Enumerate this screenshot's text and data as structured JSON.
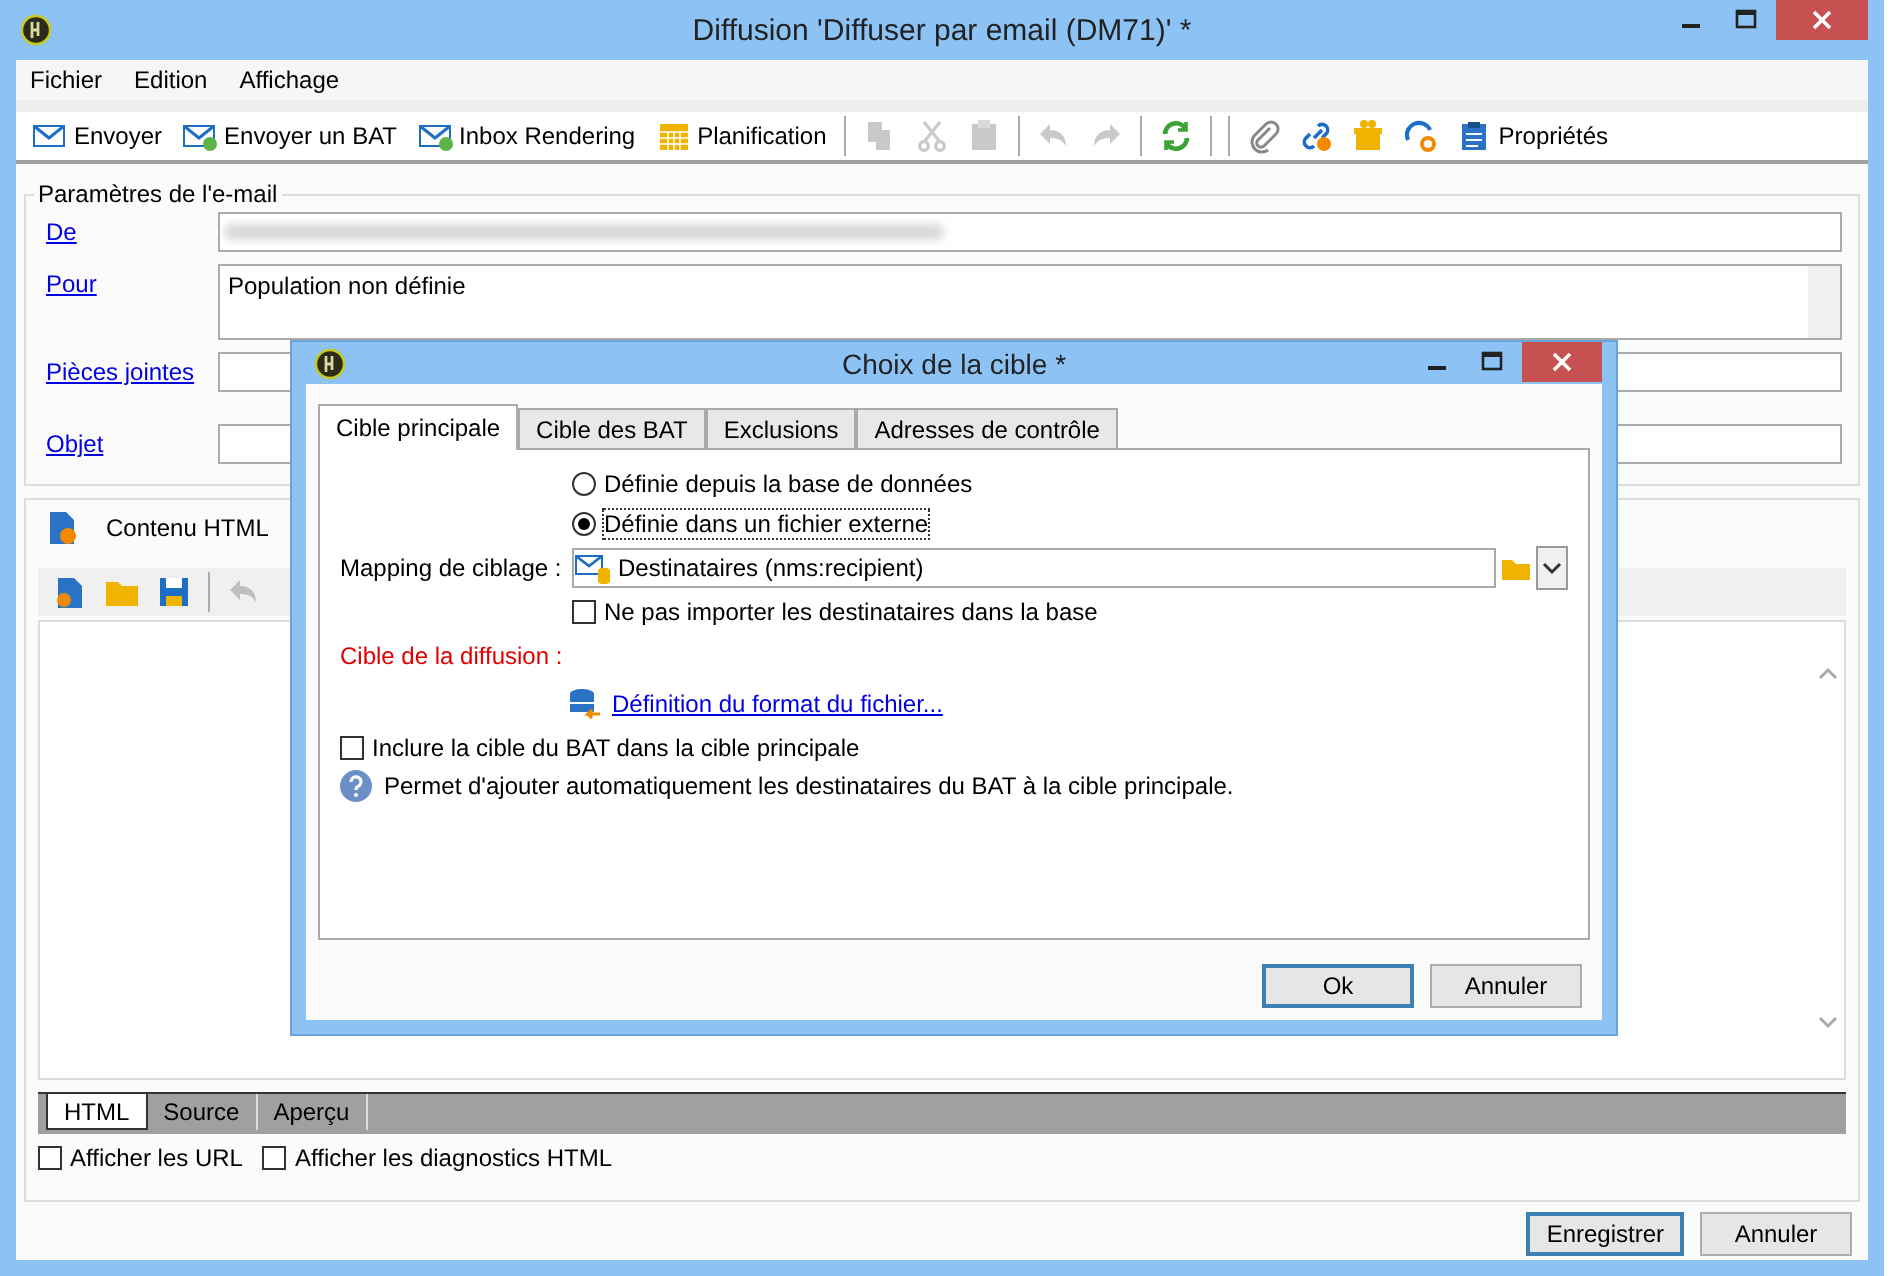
{
  "window": {
    "title": "Diffusion 'Diffuser par email (DM71)' *"
  },
  "menu": [
    "Fichier",
    "Edition",
    "Affichage"
  ],
  "toolbar": [
    {
      "kind": "button",
      "label": "Envoyer",
      "disabled": false
    },
    {
      "kind": "button",
      "label": "Envoyer un BAT",
      "disabled": false
    },
    {
      "kind": "button",
      "label": "Inbox Rendering",
      "disabled": false
    },
    {
      "kind": "button",
      "label": "Planification",
      "disabled": false
    },
    {
      "kind": "separator"
    },
    {
      "kind": "icon",
      "disabled": true
    },
    {
      "kind": "icon",
      "disabled": true
    },
    {
      "kind": "icon",
      "disabled": true
    },
    {
      "kind": "separator"
    },
    {
      "kind": "icon",
      "disabled": true
    },
    {
      "kind": "icon",
      "disabled": true
    },
    {
      "kind": "separator"
    },
    {
      "kind": "icon",
      "disabled": false
    },
    {
      "kind": "separator"
    },
    {
      "kind": "separator"
    },
    {
      "kind": "icon",
      "disabled": false
    },
    {
      "kind": "icon",
      "disabled": false
    },
    {
      "kind": "icon",
      "disabled": false
    },
    {
      "kind": "icon",
      "disabled": false
    },
    {
      "kind": "button",
      "label": "Propriétés",
      "disabled": false
    }
  ],
  "email_params": {
    "title": "Paramètres de l'e-mail",
    "fields": [
      {
        "label": "De",
        "kind": "blurred"
      },
      {
        "label": "Pour",
        "kind": "multiline",
        "value": "Population non définie"
      },
      {
        "label": "Pièces jointes",
        "kind": "text"
      },
      {
        "label": "Objet",
        "kind": "text"
      }
    ]
  },
  "content": {
    "title": "Contenu HTML",
    "editor_toolbar": [
      {
        "disabled": false
      },
      {
        "disabled": false
      },
      {
        "disabled": false
      },
      {
        "disabled": true
      }
    ],
    "view_tabs": [
      {
        "label": "HTML",
        "selected": true
      },
      {
        "label": "Source",
        "selected": false
      },
      {
        "label": "Aperçu",
        "selected": false
      }
    ],
    "options": [
      {
        "label": "Afficher les URL",
        "checked": false
      },
      {
        "label": "Afficher les diagnostics HTML",
        "checked": false
      }
    ]
  },
  "buttons": [
    "Enregistrer",
    "Annuler"
  ],
  "dialog": {
    "title": "Choix de la cible *",
    "tabs": [
      {
        "label": "Cible principale",
        "selected": true
      },
      {
        "label": "Cible des BAT",
        "selected": false
      },
      {
        "label": "Exclusions",
        "selected": false
      },
      {
        "label": "Adresses de contrôle",
        "selected": false
      }
    ],
    "radios": [
      {
        "label": "Définie depuis la base de données",
        "selected": false
      },
      {
        "label": "Définie dans un fichier externe",
        "selected": true
      }
    ],
    "mapping": {
      "label": "Mapping de ciblage :",
      "value": "Destinataires (nms:recipient)"
    },
    "no_import": {
      "label": "Ne pas importer les destinataires dans la base",
      "checked": false
    },
    "target_label": "Cible de la diffusion :",
    "format_link": "Définition du format du fichier...",
    "include_bat": {
      "label": "Inclure la cible du BAT dans la cible principale",
      "checked": false
    },
    "help": "Permet d'ajouter automatiquement les destinataires du BAT à la cible principale.",
    "buttons": [
      "Ok",
      "Annuler"
    ]
  }
}
